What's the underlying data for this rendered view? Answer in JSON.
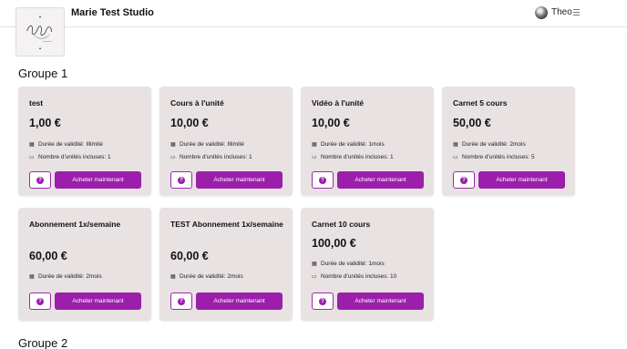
{
  "header": {
    "studio_name": "Marie Test Studio",
    "user_name": "Theo",
    "accent": "#9b1fab"
  },
  "groups": [
    {
      "title": "Groupe 1",
      "cards": [
        {
          "name": "test",
          "price": "1,00 €",
          "lines": [
            {
              "icon": "calendar-icon",
              "text": "Durée de validité: Illimité"
            },
            {
              "icon": "ticket-icon",
              "text": "Nombre d'unités incluses: 1"
            }
          ],
          "buy_label": "Acheter maintenant",
          "info_label": "?"
        },
        {
          "name": "Cours à l'unité",
          "price": "10,00 €",
          "lines": [
            {
              "icon": "calendar-icon",
              "text": "Durée de validité: Illimité"
            },
            {
              "icon": "ticket-icon",
              "text": "Nombre d'unités incluses: 1"
            }
          ],
          "buy_label": "Acheter maintenant",
          "info_label": "?"
        },
        {
          "name": "Vidéo à l'unité",
          "price": "10,00 €",
          "lines": [
            {
              "icon": "calendar-icon",
              "text": "Durée de validité: 1mois"
            },
            {
              "icon": "ticket-icon",
              "text": "Nombre d'unités incluses: 1"
            }
          ],
          "buy_label": "Acheter maintenant",
          "info_label": "?"
        },
        {
          "name": "Carnet 5 cours",
          "price": "50,00 €",
          "lines": [
            {
              "icon": "calendar-icon",
              "text": "Durée de validité: 2mois"
            },
            {
              "icon": "ticket-icon",
              "text": "Nombre d'unités incluses: 5"
            }
          ],
          "buy_label": "Acheter maintenant",
          "info_label": "?"
        },
        {
          "name": "Abonnement 1x/semaine",
          "price": "60,00 €",
          "lines": [
            {
              "icon": "calendar-icon",
              "text": "Durée de validité: 2mois"
            }
          ],
          "buy_label": "Acheter maintenant",
          "info_label": "?"
        },
        {
          "name": "TEST Abonnement 1x/semaine",
          "price": "60,00 €",
          "lines": [
            {
              "icon": "calendar-icon",
              "text": "Durée de validité: 2mois"
            }
          ],
          "buy_label": "Acheter maintenant",
          "info_label": "?"
        },
        {
          "name": "Carnet 10 cours",
          "price": "100,00 €",
          "lines": [
            {
              "icon": "calendar-icon",
              "text": "Durée de validité: 1mois"
            },
            {
              "icon": "ticket-icon",
              "text": "Nombre d'unités incluses: 10"
            }
          ],
          "buy_label": "Acheter maintenant",
          "info_label": "?"
        }
      ]
    },
    {
      "title": "Groupe 2",
      "cards": []
    }
  ]
}
